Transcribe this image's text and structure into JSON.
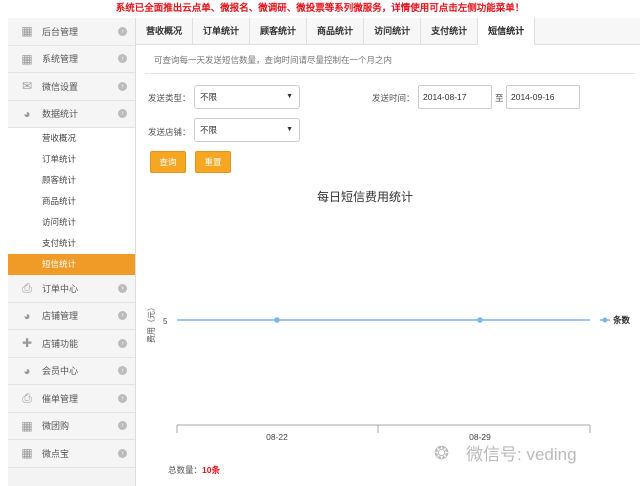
{
  "banner": "系统已全面推出云点单、微报名、微调研、微投票等系列微服务，详情使用可点击左侧功能菜单！",
  "sidebar": {
    "items_top": [
      {
        "label": "后台管理",
        "icon": "grid-icon"
      },
      {
        "label": "系统管理",
        "icon": "grid-icon"
      },
      {
        "label": "微信设置",
        "icon": "mail-icon"
      },
      {
        "label": "数据统计",
        "icon": "pie-icon"
      }
    ],
    "sub_items": [
      "营收概况",
      "订单统计",
      "顾客统计",
      "商品统计",
      "访问统计",
      "支付统计",
      "短信统计"
    ],
    "items_bottom": [
      {
        "label": "订单中心",
        "icon": "printer-icon"
      },
      {
        "label": "店铺管理",
        "icon": "pie-icon"
      },
      {
        "label": "店铺功能",
        "icon": "plus-icon"
      },
      {
        "label": "会员中心",
        "icon": "pie-icon"
      },
      {
        "label": "催单管理",
        "icon": "printer-icon"
      },
      {
        "label": "微团购",
        "icon": "grid-icon"
      },
      {
        "label": "微点宝",
        "icon": "grid-icon"
      }
    ]
  },
  "tabs": [
    "营收概况",
    "订单统计",
    "顾客统计",
    "商品统计",
    "访问统计",
    "支付统计",
    "短信统计"
  ],
  "active_tab": 6,
  "hint": "可查询每一天发送短信数量，查询时间请尽量控制在一个月之内",
  "filters": {
    "type_label": "发送类型：",
    "type_value": "不限",
    "store_label": "发送店铺：",
    "store_value": "不限",
    "time_label": "发送时间：",
    "date_from": "2014-08-17",
    "to_label": "至",
    "date_to": "2014-09-16",
    "query_label": "查询",
    "reset_label": "重置"
  },
  "chart_data": {
    "type": "line",
    "title": "每日短信费用统计",
    "ylabel": "费用（元）",
    "categories": [
      "08-22",
      "08-29"
    ],
    "series": [
      {
        "name": "条数",
        "values": [
          5,
          5
        ]
      }
    ],
    "y_tick": "5",
    "color": "#7cb5ec"
  },
  "total": {
    "label": "总数量：",
    "value": "10条"
  },
  "watermark": "微信号: veding"
}
